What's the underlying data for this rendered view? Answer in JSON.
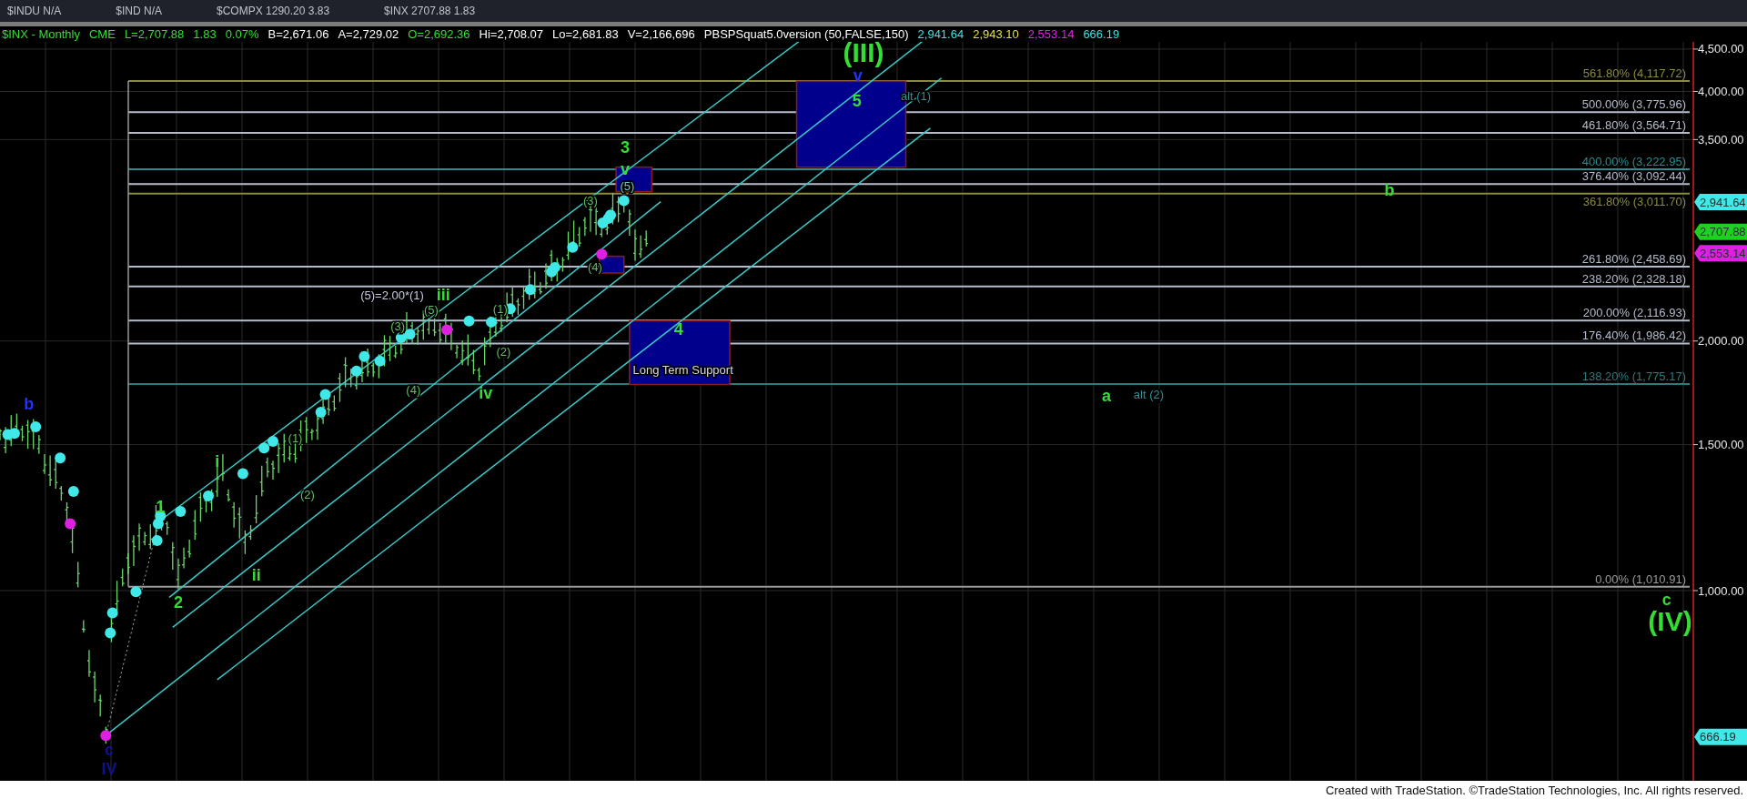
{
  "quote_tabs": [
    {
      "text": "$INDU N/A"
    },
    {
      "text": "$IND N/A"
    },
    {
      "text": "$COMPX 1290.20 3.83"
    },
    {
      "text": "$INX 2707.88 1.83"
    }
  ],
  "status_line": [
    {
      "text": "$INX - Monthly",
      "color": "#33dd33"
    },
    {
      "text": "CME",
      "color": "#33dd33"
    },
    {
      "text": "L=2,707.88",
      "color": "#33dd33"
    },
    {
      "text": "1.83",
      "color": "#33dd33"
    },
    {
      "text": "0.07%",
      "color": "#33dd33"
    },
    {
      "text": "B=2,671.06",
      "color": "#ffffff"
    },
    {
      "text": "A=2,729.02",
      "color": "#ffffff"
    },
    {
      "text": "O=2,692.36",
      "color": "#33dd33"
    },
    {
      "text": "Hi=2,708.07",
      "color": "#ffffff"
    },
    {
      "text": "Lo=2,681.83",
      "color": "#ffffff"
    },
    {
      "text": "V=2,166,696",
      "color": "#ffffff"
    },
    {
      "text": "PBSPSquat5.0version (50,FALSE,150)",
      "color": "#ffffff"
    },
    {
      "text": "2,941.64",
      "color": "#40e0e0"
    },
    {
      "text": "2,943.10",
      "color": "#e0e040"
    },
    {
      "text": "2,553.14",
      "color": "#e020e0"
    },
    {
      "text": "666.19",
      "color": "#40e0e0"
    }
  ],
  "chart": {
    "fib_levels": [
      {
        "label": "561.80% (4,117.72)",
        "color": "#8a8a40"
      },
      {
        "label": "500.00% (3,775.96)",
        "color": "#b4bccc"
      },
      {
        "label": "461.80% (3,564.71)",
        "color": "#b4bccc"
      },
      {
        "label": "400.00% (3,222.95)",
        "color": "#2a8c8c"
      },
      {
        "label": "376.40% (3,092.44)",
        "color": "#b4bccc"
      },
      {
        "label": "361.80% (3,011.70)",
        "color": "#8a8a40"
      },
      {
        "label": "261.80% (2,458.69)",
        "color": "#b4bccc"
      },
      {
        "label": "238.20% (2,328.18)",
        "color": "#b4bccc"
      },
      {
        "label": "200.00% (2,116.93)",
        "color": "#b4bccc"
      },
      {
        "label": "176.40% (1,986.42)",
        "color": "#b4bccc"
      },
      {
        "label": "138.20% (1,775.17)",
        "color": "#2f7a7a"
      },
      {
        "label": "0.00% (1,010.91)",
        "color": "#9a9a9a"
      }
    ],
    "annotations": [
      {
        "text": "(III)",
        "color": "#33dd33",
        "kind": "major"
      },
      {
        "text": "v",
        "color": "#2233ff",
        "kind": "wave"
      },
      {
        "text": "5",
        "color": "#33dd33",
        "kind": "wave"
      },
      {
        "text": "alt (1)",
        "color": "#2f8f9a",
        "kind": "minor"
      },
      {
        "text": "3",
        "color": "#33dd33",
        "kind": "wave"
      },
      {
        "text": "v",
        "color": "#33dd33",
        "kind": "wave"
      },
      {
        "text": "(5)",
        "color": "#70c8c8",
        "kind": "minor"
      },
      {
        "text": "(3)",
        "color": "#5fbf5f",
        "kind": "minor"
      },
      {
        "text": "(4)",
        "color": "#5fbf5f",
        "kind": "minor"
      },
      {
        "text": "(5)=2.00*(1)",
        "color": "#c8c8dc",
        "kind": "minor"
      },
      {
        "text": "iii",
        "color": "#33dd33",
        "kind": "wave"
      },
      {
        "text": "(5)",
        "color": "#5fbf5f",
        "kind": "minor"
      },
      {
        "text": "(3)",
        "color": "#5fbf5f",
        "kind": "minor"
      },
      {
        "text": "(4)",
        "color": "#5fbf5f",
        "kind": "minor"
      },
      {
        "text": "iv",
        "color": "#33dd33",
        "kind": "wave"
      },
      {
        "text": "(1)",
        "color": "#5fbf5f",
        "kind": "minor"
      },
      {
        "text": "(2)",
        "color": "#5fbf5f",
        "kind": "minor"
      },
      {
        "text": "4",
        "color": "#33dd33",
        "kind": "wave"
      },
      {
        "text": "Long Term Support",
        "color": "#d8d8ec",
        "kind": "minor"
      },
      {
        "text": "b",
        "color": "#33dd33",
        "kind": "wave"
      },
      {
        "text": "a",
        "color": "#33dd33",
        "kind": "wave"
      },
      {
        "text": "alt (2)",
        "color": "#2f8f9a",
        "kind": "minor"
      },
      {
        "text": "c",
        "color": "#33dd33",
        "kind": "wave"
      },
      {
        "text": "(IV)",
        "color": "#33dd33",
        "kind": "major"
      },
      {
        "text": "b",
        "color": "#2233ff",
        "kind": "wave"
      },
      {
        "text": "c",
        "color": "#101090",
        "kind": "wave"
      },
      {
        "text": "IV",
        "color": "#101090",
        "kind": "wave"
      },
      {
        "text": "1",
        "color": "#33dd33",
        "kind": "wave"
      },
      {
        "text": "i",
        "color": "#33dd33",
        "kind": "wave"
      },
      {
        "text": "(1)",
        "color": "#5fbf5f",
        "kind": "minor"
      },
      {
        "text": "(2)",
        "color": "#5fbf5f",
        "kind": "minor"
      },
      {
        "text": "ii",
        "color": "#33dd33",
        "kind": "wave"
      },
      {
        "text": "2",
        "color": "#33dd33",
        "kind": "wave"
      }
    ],
    "price_axis": {
      "ticks": [
        "4,500.00",
        "4,000.00",
        "3,500.00",
        "2,000.00",
        "1,500.00",
        "1,000.00"
      ],
      "markers": [
        {
          "text": "2,941.64",
          "color": "#40e8e8"
        },
        {
          "text": "2,707.88",
          "color": "#20d020"
        },
        {
          "text": "2,553.14",
          "color": "#e020e0"
        },
        {
          "text": "666.19",
          "color": "#40e8e8"
        }
      ]
    }
  },
  "footer": "Created with TradeStation. ©TradeStation Technologies, Inc. All rights reserved."
}
